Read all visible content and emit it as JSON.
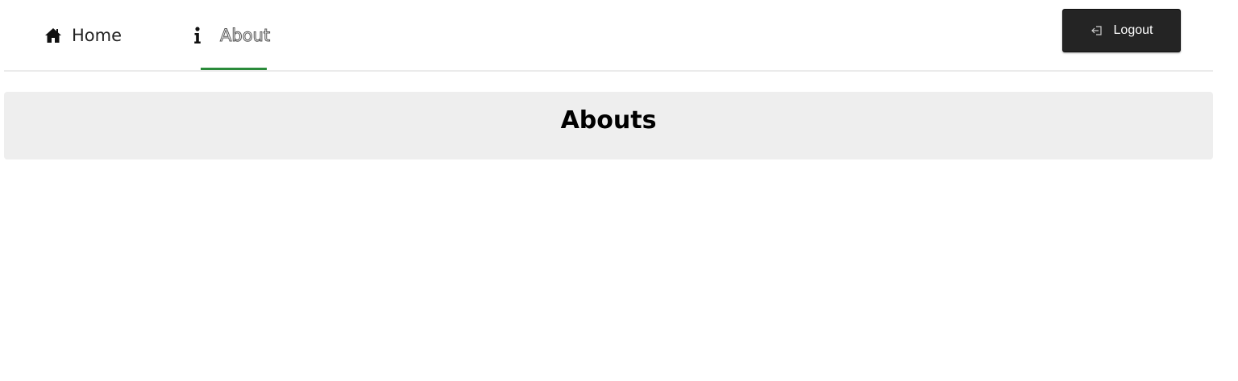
{
  "nav": {
    "items": [
      {
        "label": "Home",
        "icon": "home-icon"
      },
      {
        "label": "About",
        "icon": "info-icon",
        "active": true
      }
    ],
    "active_color": "#2a8b3a"
  },
  "logout": {
    "label": "Logout",
    "icon": "logout-icon"
  },
  "main": {
    "title": "Abouts"
  }
}
